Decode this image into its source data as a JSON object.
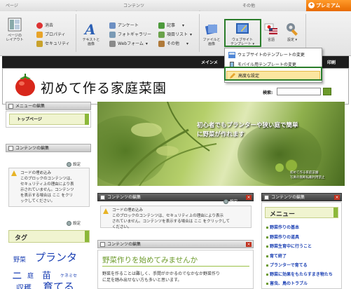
{
  "premium": "プレミアム",
  "ribbon": {
    "groups": [
      "ページ",
      "コンテンツ",
      "その他"
    ],
    "page": {
      "layout_label_1": "ページの",
      "layout_label_2": "レイアウト",
      "delete": "消去",
      "property": "プロパティ",
      "security": "セキュリティ"
    },
    "content": {
      "text_images_1": "テキストと",
      "text_images_2": "画像",
      "survey": "アンケート",
      "photo_gallery": "フォトギャラリー",
      "web_form": "Webフォーム",
      "article": "記事",
      "item_list": "項目リスト",
      "other": "その他"
    },
    "misc": {
      "files_1": "ファイルと",
      "files_2": "画像",
      "website_1": "ウェブサイト",
      "website_2": "テンプレート",
      "language": "言語",
      "settings": "設定"
    }
  },
  "dropdown": {
    "items": [
      "ウェブサイトのテンプレートの変更",
      "モバイル用テンプレートの変更",
      "高度な設定"
    ]
  },
  "adminbar": {
    "main_menu": "メインメ",
    "print": "印刷"
  },
  "site": {
    "title": "初めて作る家庭菜園",
    "search_label": "検索:"
  },
  "left": {
    "menu_edit": "メニューの編集",
    "top_page": "トップページ",
    "content_edit": "コンテンツの編集",
    "settings": "設定",
    "embed_title": "コードの埋め込み",
    "embed_body_1": "このブロックのコンテンツは、",
    "embed_body_2": "セキュリティ上の理由により表",
    "embed_body_3": "示されていません。コンテンツ",
    "embed_body_4": "を表示する場合は ここ をクリ",
    "embed_body_5": "ックしてください。",
    "settings2": "設定",
    "tag_title": "タグ",
    "tags": [
      "野菜",
      "プランタ",
      "ニ",
      "庭",
      "苗",
      "ケネミセ",
      "収穫",
      "育てる"
    ]
  },
  "hero": {
    "line1": "初心者でもプランターや狭い庭で簡単",
    "line2": "に野菜が作れます",
    "cap1": "初めて作る家庭菜園",
    "cap2": "写真の無断転載利用禁止"
  },
  "center": {
    "content_edit": "コンテンツの編集",
    "settings": "設定",
    "embed_title": "コードの埋め込み",
    "embed_body_1": "このブロックのコンテンツは、セキュリティ上の理由により表示",
    "embed_body_2": "されていません。コンテンツを表示する場合は ここ をクリックして",
    "embed_body_3": "ください。",
    "content_edit2": "コンテンツの編集",
    "heading": "野菜作りを始めてみませんか",
    "body_1": "野菜を作ることは難しく、手間がかかるのでなかなか野菜作り",
    "body_2": "に足を踏み出せない方も多いと思います。"
  },
  "right": {
    "content_edit": "コンテンツの編集",
    "menu_title": "メニュー",
    "links": [
      "野菜作りの基本",
      "野菜作りの道具",
      "野菜生育中に行うこと",
      "育て終了",
      "プランターで育てる",
      "野菜に効果をもたらすまき物たち",
      "害虫、鳥のトラブル"
    ]
  }
}
